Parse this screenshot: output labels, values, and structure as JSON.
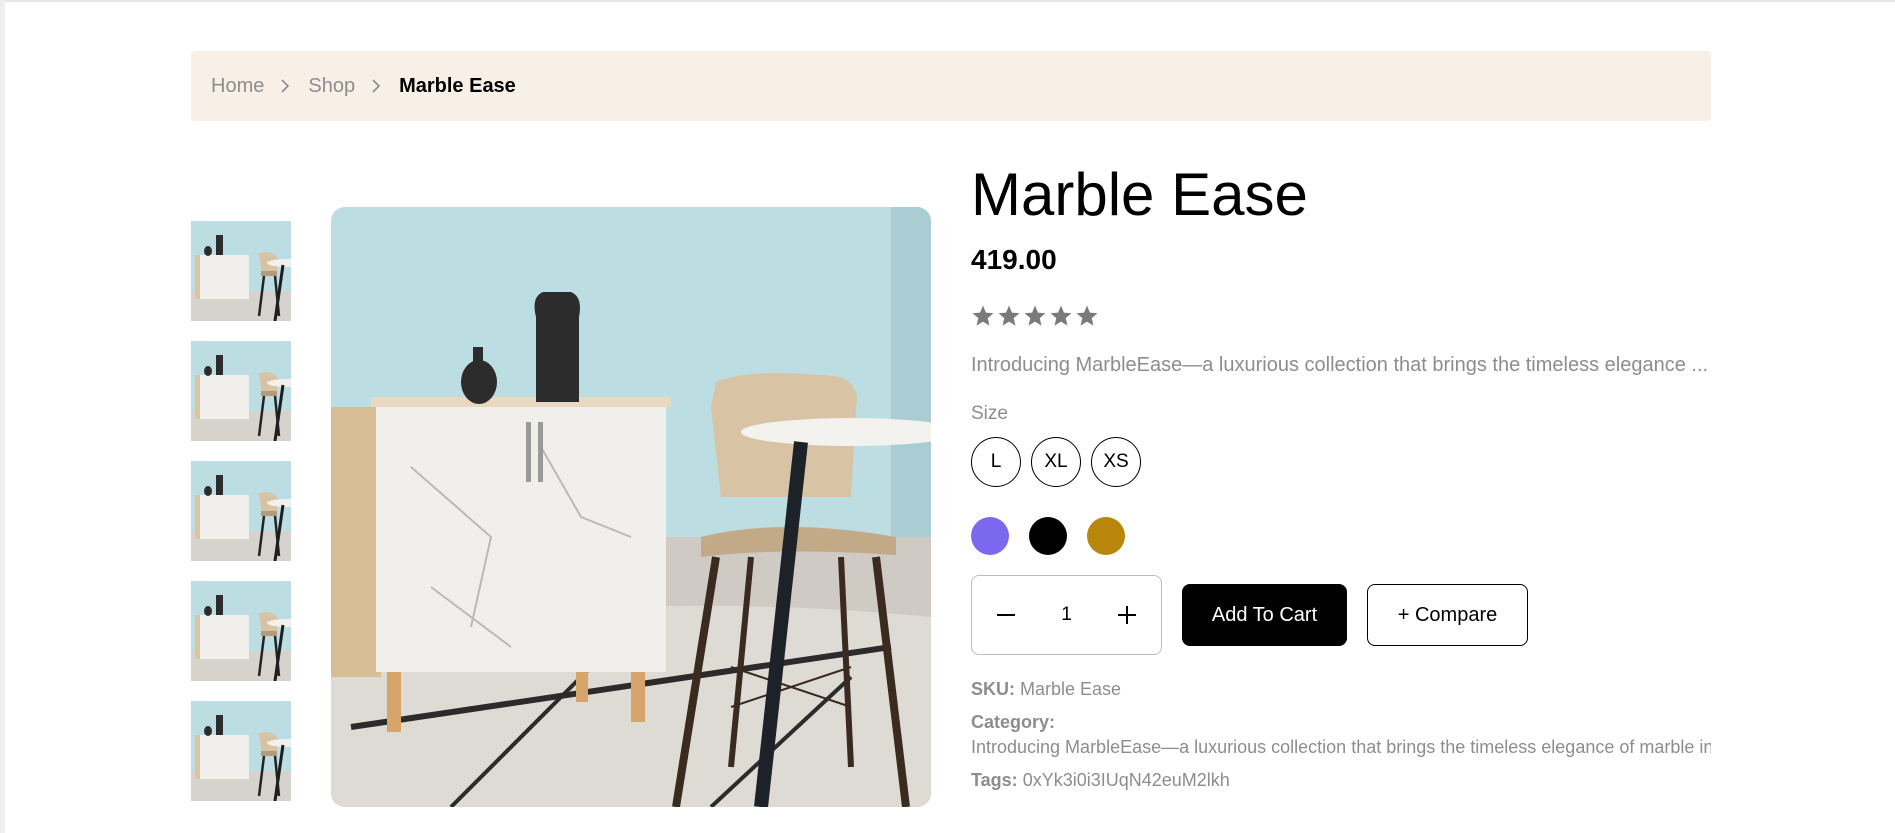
{
  "breadcrumb": {
    "home": "Home",
    "shop": "Shop",
    "current": "Marble Ease"
  },
  "product": {
    "title": "Marble Ease",
    "price": "419.00",
    "rating": {
      "value": 0,
      "max": 5,
      "star_color": "#7a7a7a"
    },
    "description": "Introducing MarbleEase—a luxurious collection that brings the timeless elegance ...",
    "size_label": "Size",
    "sizes": [
      "L",
      "XL",
      "XS"
    ],
    "colors": [
      "#7b68ee",
      "#000000",
      "#b8860b"
    ],
    "quantity": "1",
    "add_to_cart": "Add To Cart",
    "compare": "+ Compare",
    "sku_label": "SKU:",
    "sku_value": "Marble Ease",
    "category_label": "Category:",
    "category_value": "Introducing MarbleEase—a luxurious collection that brings the timeless elegance of marble int...",
    "tags_label": "Tags:",
    "tags_value": "0xYk3i0i3IUqN42euM2lkh"
  },
  "icons": {
    "breadcrumb_separator": "chevron-right-icon",
    "star": "star-icon",
    "minus": "minus-icon",
    "plus": "plus-icon"
  },
  "theme": {
    "breadcrumb_bg": "#f8efe7",
    "muted_text": "#8d8d8d",
    "primary_button": "#000000"
  }
}
